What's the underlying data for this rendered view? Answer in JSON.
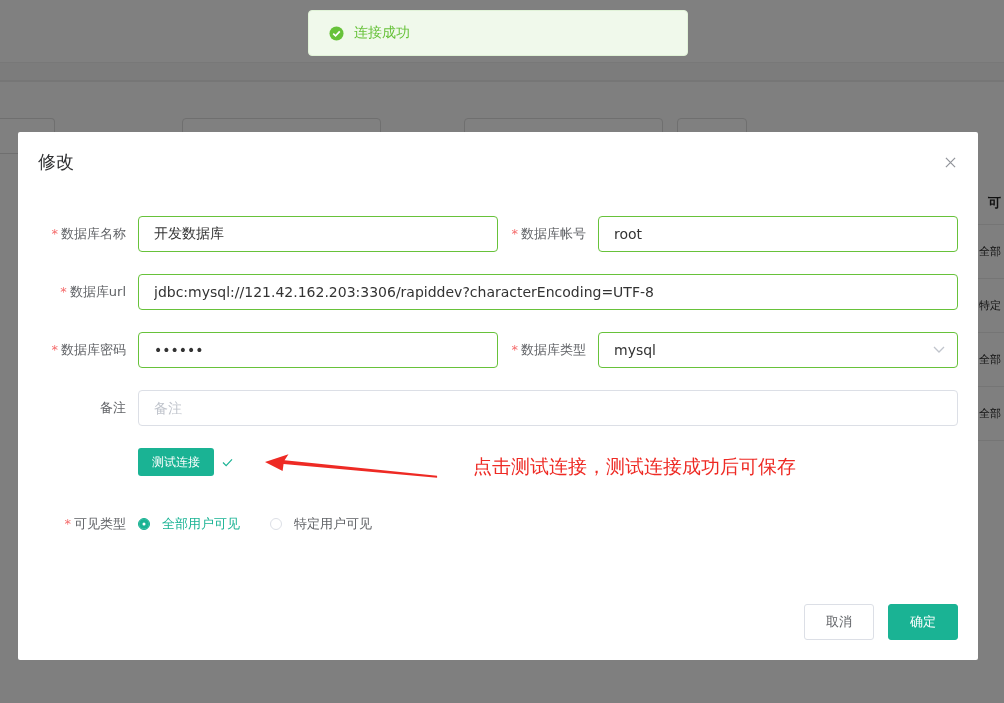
{
  "toast": {
    "text": "连接成功"
  },
  "background_table": {
    "header": "可",
    "cells": [
      "全部",
      "特定",
      "全部",
      "全部"
    ]
  },
  "dialog": {
    "title": "修改",
    "rows": [
      [
        {
          "label": "数据库名称",
          "required_mark": "*",
          "kind": "text",
          "value": "开发数据库"
        },
        {
          "label": "数据库帐号",
          "required_mark": "*",
          "kind": "text",
          "value": "root"
        }
      ],
      [
        {
          "label": "数据库url",
          "required_mark": "*",
          "kind": "text",
          "value": "jdbc:mysql://121.42.162.203:3306/rapiddev?characterEncoding=UTF-8"
        }
      ],
      [
        {
          "label": "数据库密码",
          "required_mark": "*",
          "kind": "text",
          "value": "••••••"
        },
        {
          "label": "数据库类型",
          "required_mark": "*",
          "kind": "select",
          "value": "mysql"
        }
      ],
      [
        {
          "label": "备注",
          "kind": "text",
          "placeholder": "备注"
        }
      ]
    ],
    "test_button": {
      "label": "测试连接",
      "passed": true
    },
    "annotation": "点击测试连接，测试连接成功后可保存",
    "visibility": {
      "label": "可见类型",
      "required_mark": "*",
      "options": [
        {
          "label": "全部用户可见",
          "selected": true
        },
        {
          "label": "特定用户可见",
          "selected": false
        }
      ]
    },
    "buttons": [
      {
        "label": "取消",
        "kind": "default"
      },
      {
        "label": "确定",
        "kind": "primary"
      }
    ]
  }
}
